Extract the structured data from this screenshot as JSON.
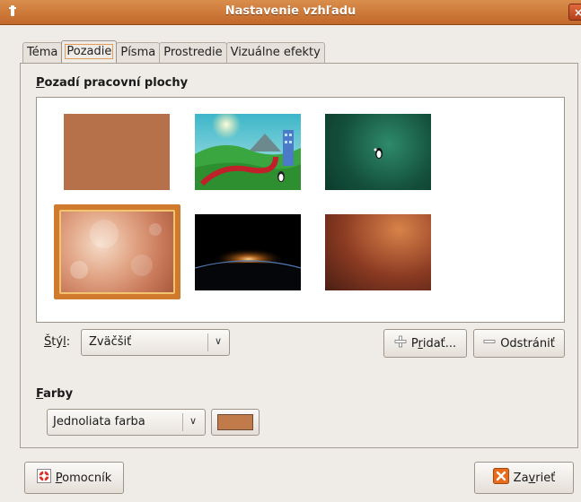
{
  "window": {
    "title": "Nastavenie vzhľadu",
    "menu_icon": "window-menu-icon",
    "close_label": "×"
  },
  "tabs": [
    {
      "label": "Téma",
      "active": false
    },
    {
      "label": "Pozadie",
      "active": true
    },
    {
      "label": "Písma",
      "active": false
    },
    {
      "label": "Prostredie",
      "active": false
    },
    {
      "label": "Vizuálne efekty",
      "active": false
    }
  ],
  "background_section": {
    "title_first": "P",
    "title_rest": "ozadí pracovní plochy",
    "wallpapers": [
      {
        "name": "solid-brown",
        "selected": false
      },
      {
        "name": "landscape-cartoon",
        "selected": false
      },
      {
        "name": "green-penguin",
        "selected": false
      },
      {
        "name": "warm-bokeh",
        "selected": true
      },
      {
        "name": "space-sunrise",
        "selected": false
      },
      {
        "name": "brown-gradient",
        "selected": false
      }
    ],
    "style_label_first": "Š",
    "style_label_mid": "tý",
    "style_label_ul": "l",
    "style_label_end": ":",
    "style_value": "Zväčšiť",
    "add_button_pre": "P",
    "add_button_ul": "r",
    "add_button_post": "idať...",
    "remove_button": "Odstrániť"
  },
  "colors_section": {
    "title_first": "F",
    "title_rest": "arby",
    "fill_value": "Jednoliata farba",
    "swatch_color": "#c17a4a"
  },
  "footer": {
    "help_pre": "P",
    "help_rest": "omocník",
    "close_pre": "Za",
    "close_ul": "v",
    "close_post": "rieť"
  },
  "colors": {
    "accent": "#cf7a2c",
    "titlebar": "#c2682a",
    "background": "#efebe7"
  }
}
